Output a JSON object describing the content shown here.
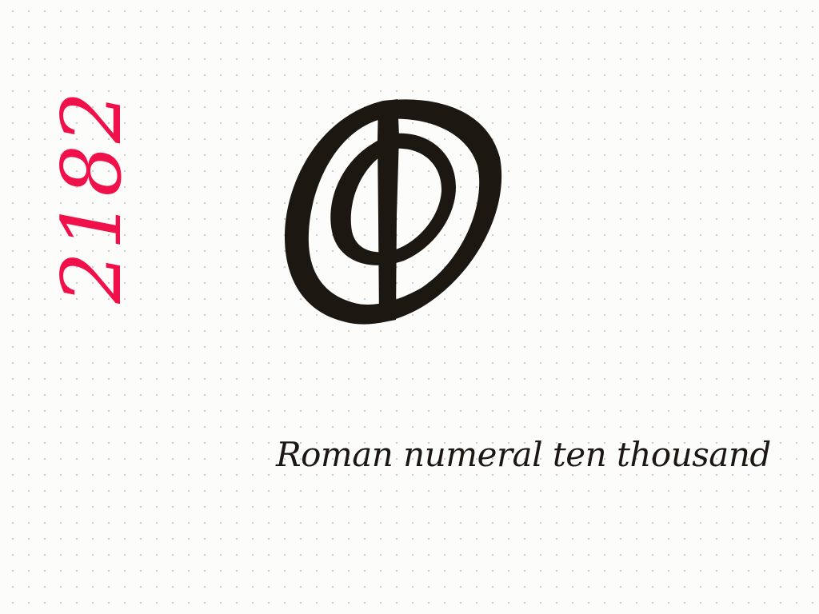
{
  "sheet": {
    "paper": "dot-grid",
    "background_color": "#fcfcfb",
    "dot_color": "#c9c9c9"
  },
  "number_label": {
    "text": "2182",
    "color": "#f0104a",
    "orientation": "rotated-vertical"
  },
  "symbol": {
    "icon": "roman-numeral-ten-thousand-icon",
    "ink_color": "#1d1712"
  },
  "caption": {
    "text": "Roman numeral  ten thousand",
    "ink_color": "#1c1712"
  }
}
